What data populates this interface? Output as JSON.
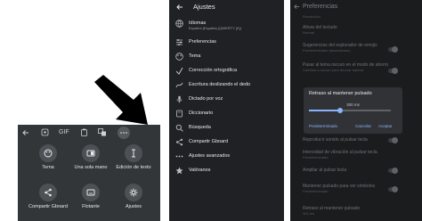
{
  "keyboard": {
    "toolbar": {
      "gif_label": "GIF"
    },
    "tiles": [
      {
        "label": "Tema",
        "icon": "palette-icon"
      },
      {
        "label": "Una sola mano",
        "icon": "one-hand-icon"
      },
      {
        "label": "Edición de texto",
        "icon": "text-cursor-icon"
      },
      {
        "label": "Compartir Gboard",
        "icon": "share-icon"
      },
      {
        "label": "Flotante",
        "icon": "floating-keyboard-icon"
      },
      {
        "label": "Ajustes",
        "icon": "gear-icon"
      }
    ]
  },
  "settings": {
    "title": "Ajustes",
    "items": [
      {
        "label": "Idiomas",
        "sublabel": "Español (España) (QWERTY (ñ))",
        "icon": "globe-icon"
      },
      {
        "label": "Preferencias",
        "icon": "sliders-icon"
      },
      {
        "label": "Tema",
        "icon": "palette-icon"
      },
      {
        "label": "Corrección ortográfica",
        "icon": "spellcheck-icon"
      },
      {
        "label": "Escritura deslizando el dedo",
        "icon": "gesture-icon"
      },
      {
        "label": "Dictado por voz",
        "icon": "mic-icon"
      },
      {
        "label": "Diccionario",
        "icon": "book-icon"
      },
      {
        "label": "Búsqueda",
        "icon": "search-icon"
      },
      {
        "label": "Compartir Gboard",
        "icon": "share-icon"
      },
      {
        "label": "Ajustes avanzados",
        "icon": "more-icon"
      },
      {
        "label": "Valóranos",
        "icon": "star-icon"
      }
    ]
  },
  "preferences": {
    "title": "Preferencias",
    "rows": [
      {
        "label": "Resolución",
        "sub": ""
      },
      {
        "label": "Altura del teclado",
        "sub": "Normal"
      },
      {
        "label": "Sugerencias del explorador de emojis",
        "sub": "Predeterminado (desactivado)"
      },
      {
        "label": "Pasar al tema oscuro en el modo de ahorro",
        "sub": "Cambiar a oscuro para ahorrar batería"
      },
      {
        "label": "Reproducir sonido al pulsar tecla",
        "sub": ""
      },
      {
        "label": "Intensidad de vibración al pulsar tecla",
        "sub": "Predeterminado"
      },
      {
        "label": "Ampliar al pulsar tecla",
        "sub": ""
      },
      {
        "label": "Mantener pulsado para ver símbolos",
        "sub": "Predeterminado"
      },
      {
        "label": "Retraso al mantener pulsado",
        "sub": "300 ms"
      }
    ],
    "dialog": {
      "title": "Retraso al mantener pulsado",
      "value": "300 ms",
      "slider_fraction": 0.38,
      "buttons": {
        "default": "Predeterminado",
        "cancel": "Cancelar",
        "accept": "Aceptar"
      }
    }
  }
}
